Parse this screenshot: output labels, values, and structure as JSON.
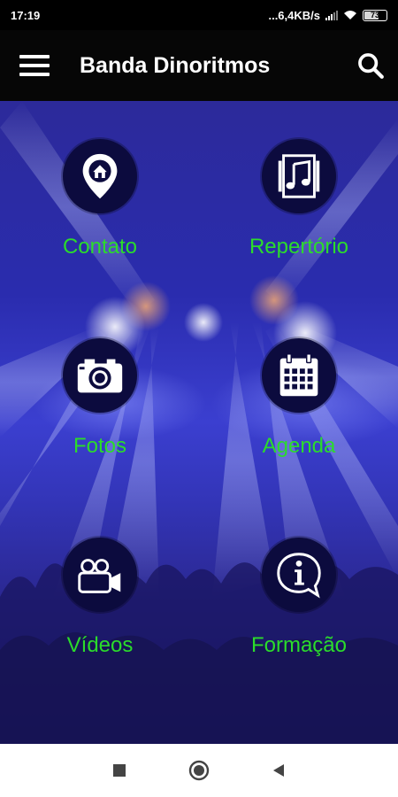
{
  "status_bar": {
    "time": "17:19",
    "network_speed": "...6,4KB/s",
    "battery_level": "73"
  },
  "app_bar": {
    "title": "Banda Dinoritmos",
    "menu_icon": "hamburger-menu-icon",
    "search_icon": "search-icon"
  },
  "menu": [
    {
      "label": "Contato",
      "icon": "home-location-pin-icon"
    },
    {
      "label": "Repertório",
      "icon": "music-note-icon"
    },
    {
      "label": "Fotos",
      "icon": "camera-icon"
    },
    {
      "label": "Agenda",
      "icon": "calendar-icon"
    },
    {
      "label": "Vídeos",
      "icon": "video-camera-icon"
    },
    {
      "label": "Formação",
      "icon": "info-bubble-icon"
    }
  ],
  "nav_bar": {
    "recents_icon": "square-recents-icon",
    "home_icon": "circle-home-icon",
    "back_icon": "triangle-back-icon"
  },
  "colors": {
    "label_green": "#2bdc2b",
    "icon_circle": "#0c0b3e",
    "background_blue": "#2c2aa8"
  }
}
